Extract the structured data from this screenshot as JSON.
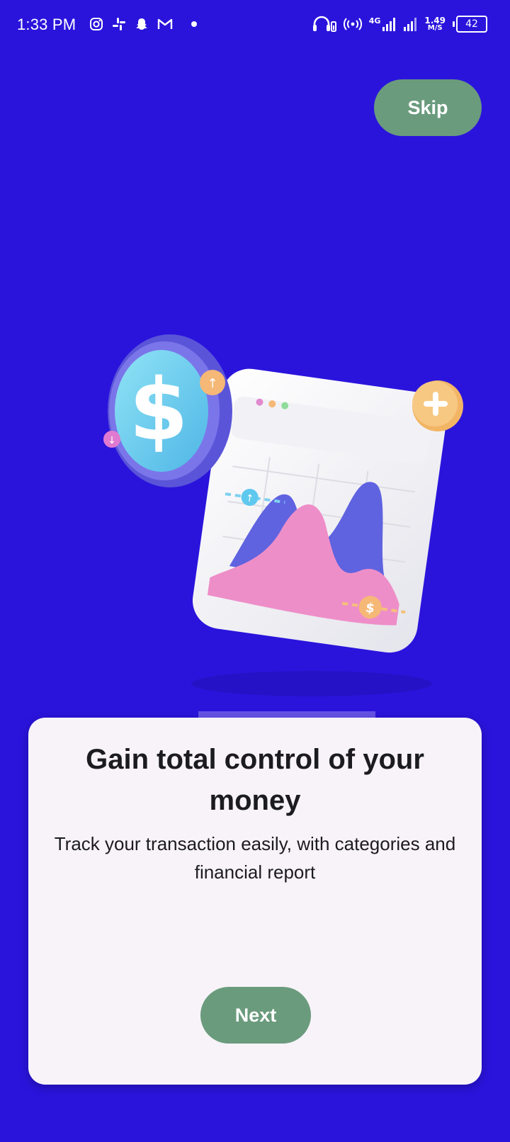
{
  "status_bar": {
    "time": "1:33 PM",
    "left_icons": [
      "instagram-icon",
      "slack-icon",
      "snapchat-icon",
      "gmail-icon",
      "dot-icon"
    ],
    "right_icons": [
      "headphones-icon",
      "hotspot-icon",
      "signal-4g-icon",
      "signal-icon"
    ],
    "network": "4G",
    "speed_value": "1.49",
    "speed_unit": "M/S",
    "battery": "42"
  },
  "onboarding": {
    "skip_label": "Skip",
    "title": "Gain total control of your money",
    "subtitle": "Track your transaction easily, with categories and financial report",
    "next_label": "Next"
  },
  "colors": {
    "background": "#2a14dc",
    "button": "#6a9b7d",
    "card": "#f7f3f9",
    "text": "#1c1b1f"
  },
  "illustration": {
    "coin_symbol": "$",
    "badge_symbol": "$"
  }
}
